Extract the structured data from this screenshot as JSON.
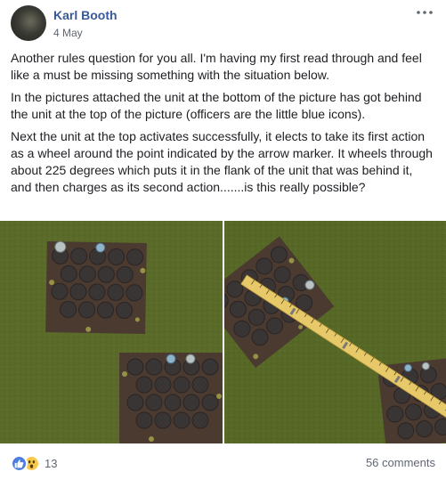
{
  "post": {
    "author": "Karl Booth",
    "date": "4 May",
    "paragraphs": [
      "Another rules question for you all. I'm having my first read through and feel like a must be missing something with the situation below.",
      "In the pictures attached the unit at the bottom of the picture has got behind the unit at the top of the picture (officers are the little blue icons).",
      "Next the unit at the top activates successfully, it elects to take its first action as a wheel around the point indicated by the arrow marker. It wheels through about 225 degrees which puts it in the flank of the unit that was behind it, and then charges as its second action.......is this really possible?"
    ]
  },
  "footer": {
    "reaction_count": "13",
    "comments": "56 comments"
  },
  "icons": {
    "more": "ellipsis-icon",
    "like": "thumbs-up-icon",
    "wow": "wow-face-icon"
  },
  "colors": {
    "name_link": "#385898",
    "secondary_text": "#616770",
    "like_blue": "#4a7fe0",
    "wow_yellow": "#f7c94a"
  }
}
